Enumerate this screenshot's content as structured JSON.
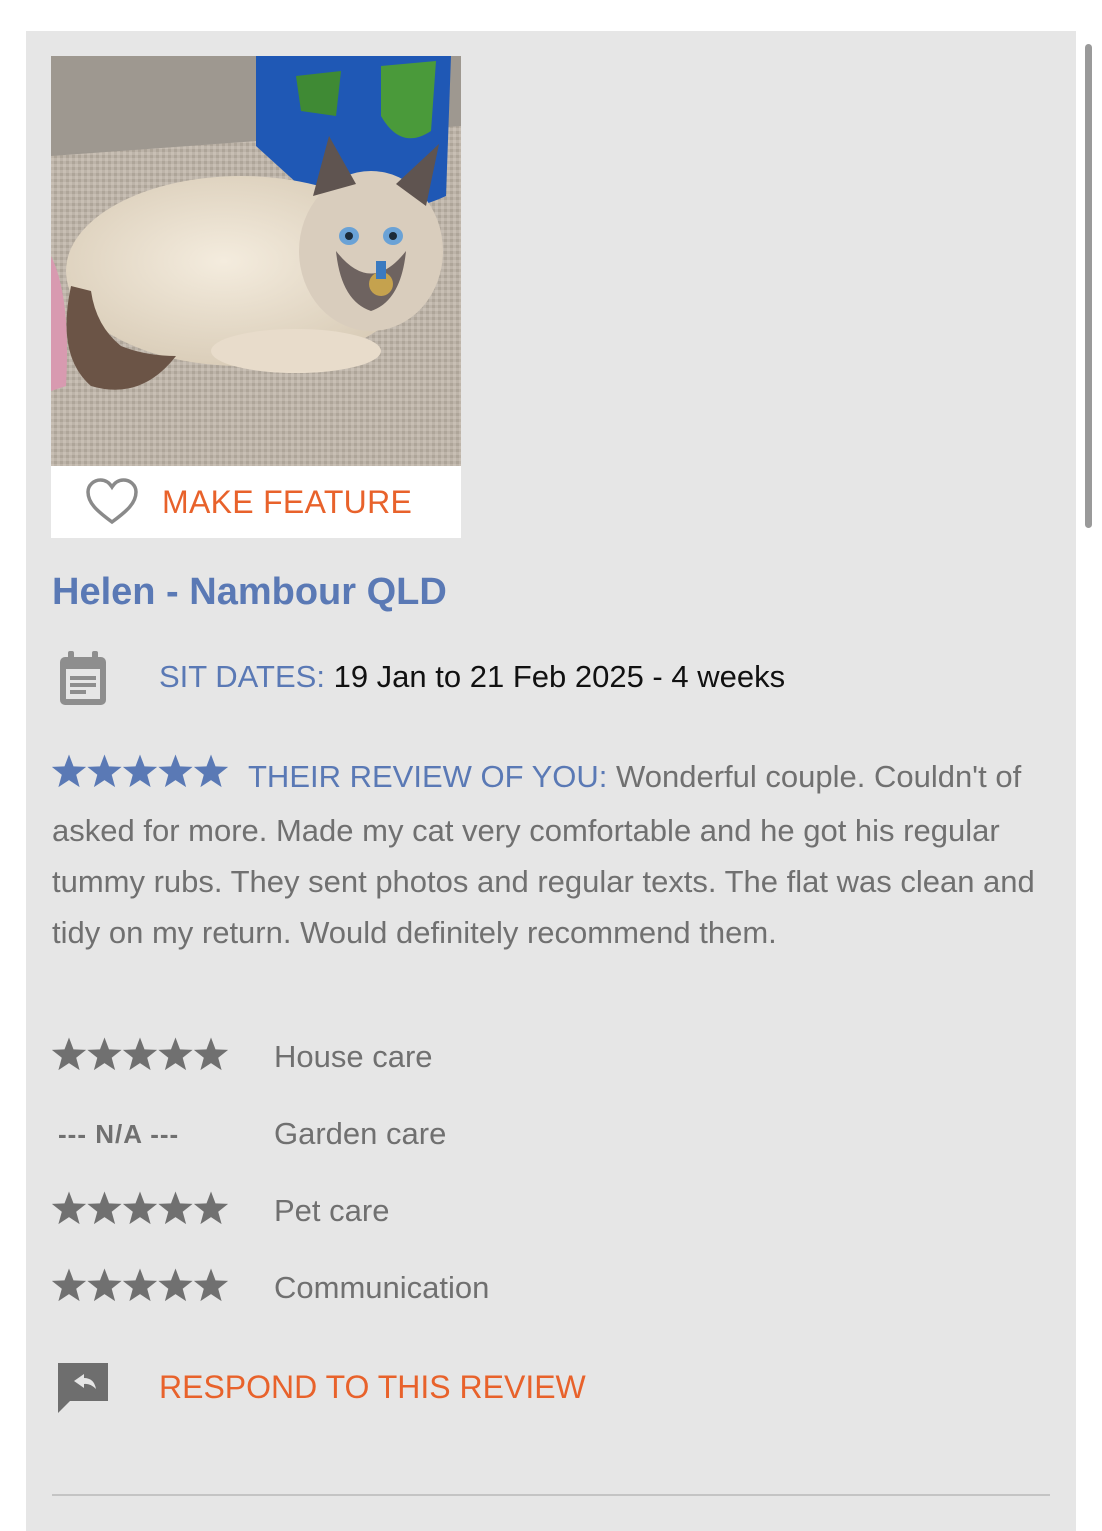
{
  "feature": {
    "label": "MAKE FEATURE",
    "icon": "heart-outline-icon"
  },
  "host": {
    "title": "Helen - Nambour QLD"
  },
  "sit": {
    "label": "SIT DATES:",
    "value": "19 Jan to 21 Feb 2025 - 4 weeks",
    "icon": "calendar-icon"
  },
  "review": {
    "rating": 5,
    "label": "THEIR REVIEW OF YOU:",
    "text": "Wonderful couple. Couldn't of asked for more. Made my cat very comfortable and he got his regular tummy rubs. They sent photos and regular texts. The flat was clean and tidy on my return. Would definitely recommend them."
  },
  "ratings": [
    {
      "category": "House care",
      "stars": 5
    },
    {
      "category": "Garden care",
      "stars": null,
      "na_text": "--- N/A ---"
    },
    {
      "category": "Pet care",
      "stars": 5
    },
    {
      "category": "Communication",
      "stars": 5
    }
  ],
  "respond": {
    "label": "RESPOND TO THIS REVIEW",
    "icon": "reply-bubble-icon"
  },
  "colors": {
    "accent_orange": "#e8622b",
    "label_blue": "#5a79b5",
    "star_blue": "#5a79b5",
    "star_gray": "#707070",
    "card_bg": "#e6e6e6"
  }
}
